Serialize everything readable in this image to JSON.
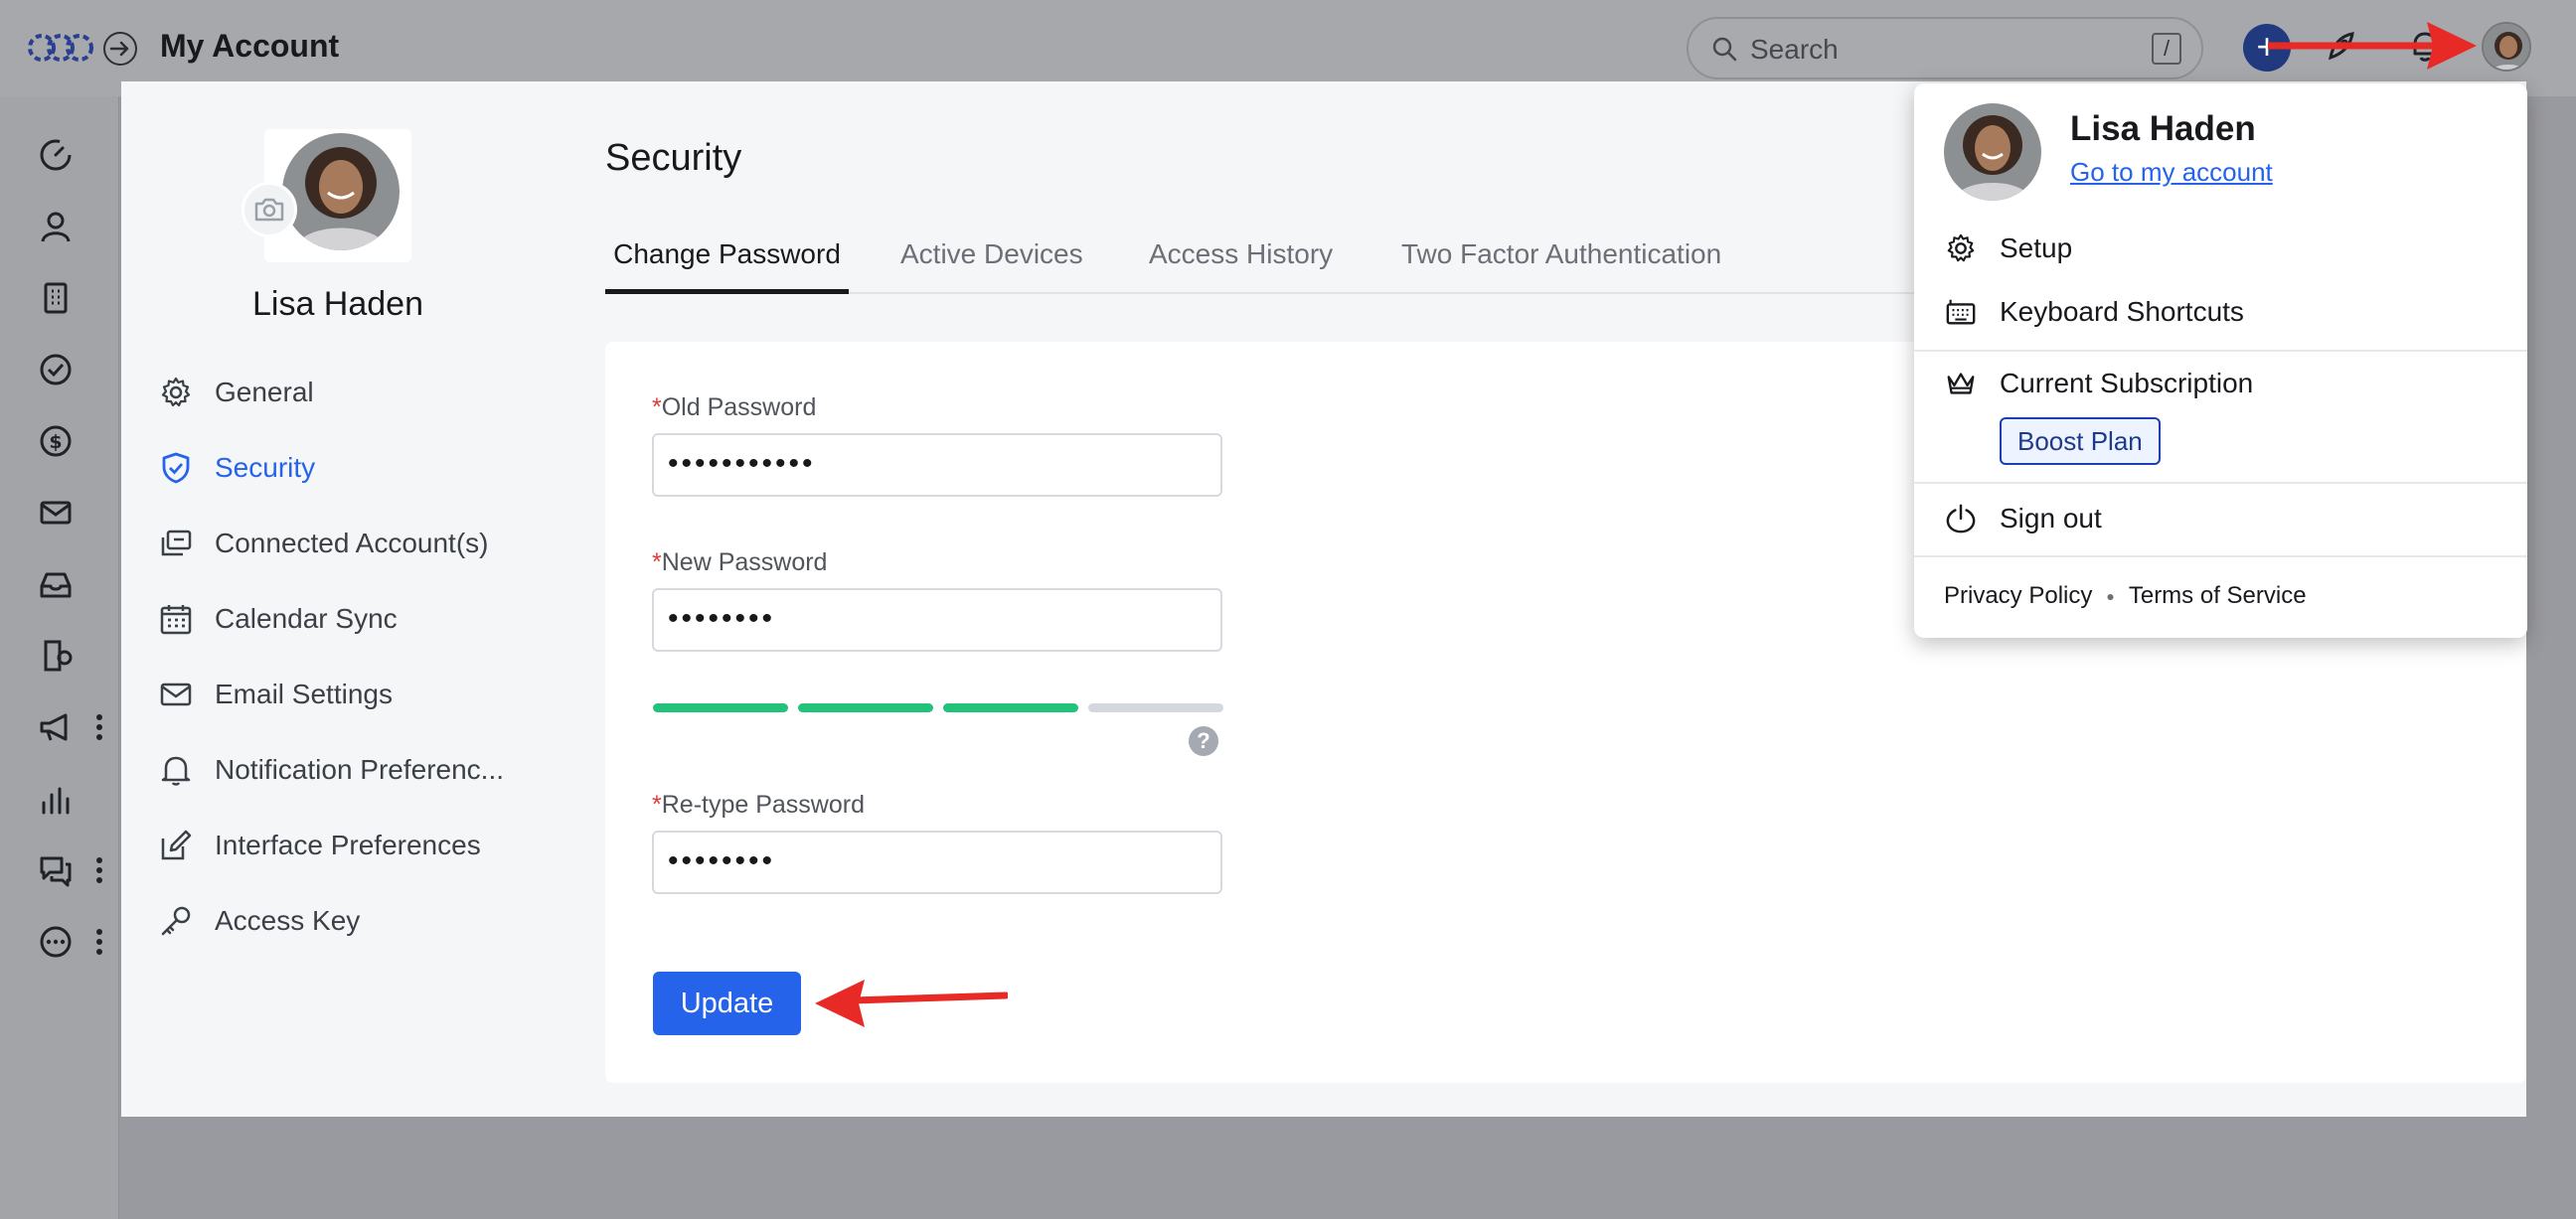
{
  "header": {
    "title": "My Account",
    "search_placeholder": "Search",
    "search_shortcut": "/",
    "add_label": "+"
  },
  "profile": {
    "name": "Lisa Haden"
  },
  "nav": {
    "items": [
      {
        "label": "General",
        "icon": "gear-icon"
      },
      {
        "label": "Security",
        "icon": "shield-icon",
        "active": true
      },
      {
        "label": "Connected Account(s)",
        "icon": "linked-accounts-icon"
      },
      {
        "label": "Calendar Sync",
        "icon": "calendar-icon"
      },
      {
        "label": "Email Settings",
        "icon": "mail-icon"
      },
      {
        "label": "Notification Preferenc...",
        "icon": "bell-icon"
      },
      {
        "label": "Interface Preferences",
        "icon": "edit-icon"
      },
      {
        "label": "Access Key",
        "icon": "key-icon"
      }
    ]
  },
  "security": {
    "title": "Security",
    "tabs": [
      {
        "label": "Change Password",
        "active": true
      },
      {
        "label": "Active Devices"
      },
      {
        "label": "Access History"
      },
      {
        "label": "Two Factor Authentication"
      }
    ],
    "form": {
      "required_mark": "*",
      "old_password_label": "Old Password",
      "old_password_value": "•••••••••••",
      "new_password_label": "New Password",
      "new_password_value": "••••••••",
      "strength_level": 0.75,
      "help": "?",
      "retype_password_label": "Re-type Password",
      "retype_password_value": "••••••••",
      "submit_label": "Update"
    }
  },
  "user_menu": {
    "name": "Lisa Haden",
    "account_link": "Go to my account",
    "setup": "Setup",
    "shortcuts": "Keyboard Shortcuts",
    "subscription": "Current Subscription",
    "plan": "Boost Plan",
    "sign_out": "Sign out",
    "privacy": "Privacy Policy",
    "terms": "Terms of Service"
  },
  "colors": {
    "accent": "#2563eb",
    "strength_on": "#22c27b",
    "strength_off": "#d4d7dd",
    "annotation_arrow": "#e82a26"
  }
}
